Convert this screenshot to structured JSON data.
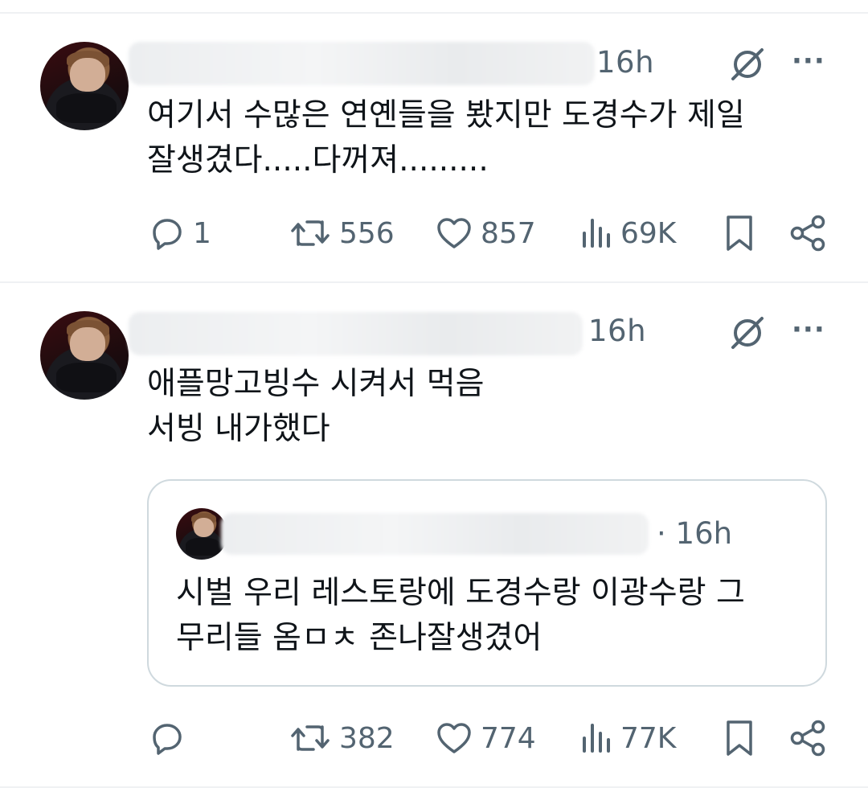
{
  "tweets": [
    {
      "time": "16h",
      "text": "여기서 수많은 연옌들을 봤지만 도경수가 제일\n잘생겼다.....다꺼져.........",
      "replies": "1",
      "retweets": "556",
      "likes": "857",
      "views": "69K"
    },
    {
      "time": "16h",
      "text": "애플망고빙수 시켜서 먹음\n서빙 내가했다",
      "replies": "",
      "retweets": "382",
      "likes": "774",
      "views": "77K",
      "quote": {
        "time": "· 16h",
        "text": "시벌 우리 레스토랑에 도경수랑 이광수랑 그\n무리들 옴ㅁㅊ 존나잘생겼어"
      }
    }
  ],
  "icons": {
    "reply": "reply-icon",
    "retweet": "retweet-icon",
    "like": "heart-icon",
    "views": "views-icon",
    "bookmark": "bookmark-icon",
    "share": "share-icon",
    "grok": "grok-icon",
    "more": "more-icon"
  },
  "colors": {
    "secondary_text": "#536471",
    "primary_text": "#0f1419",
    "border": "#cfd9de"
  }
}
